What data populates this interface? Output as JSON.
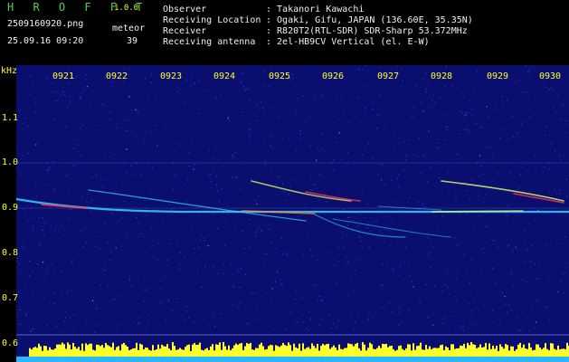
{
  "app": {
    "name": "H R O F F T",
    "version": "1.0.0"
  },
  "capture": {
    "filename": "2509160920.png",
    "datetime": "25.09.16 09:20",
    "meteor_label": "meteor",
    "meteor_count": "39"
  },
  "info": {
    "rows": [
      {
        "key": "Observer",
        "value": ": Takanori Kawachi"
      },
      {
        "key": "Receiving Location",
        "value": ": Ogaki, Gifu, JAPAN (136.60E, 35.35N)"
      },
      {
        "key": "Receiver",
        "value": ": R820T2(RTL-SDR) SDR-Sharp 53.372MHz"
      },
      {
        "key": "Receiving antenna",
        "value": ": 2el-HB9CV Vertical (el. E-W)"
      }
    ]
  },
  "spectrogram": {
    "freq_unit": "kHz",
    "time_ticks": [
      "0921",
      "0922",
      "0923",
      "0924",
      "0925",
      "0926",
      "0927",
      "0928",
      "0929",
      "0930"
    ],
    "freq_ticks": [
      "1.1",
      "1.0",
      "0.9",
      "0.8",
      "0.7",
      "0.6"
    ],
    "colors": {
      "background": "#0a0e6e",
      "noise": "#2a4bd8",
      "signal_low": "#34d2ff",
      "signal_mid": "#e8ff6a",
      "signal_high": "#ff3a5a",
      "level_bar": "#ffff2a",
      "baseline": "#2ab7ff"
    }
  }
}
